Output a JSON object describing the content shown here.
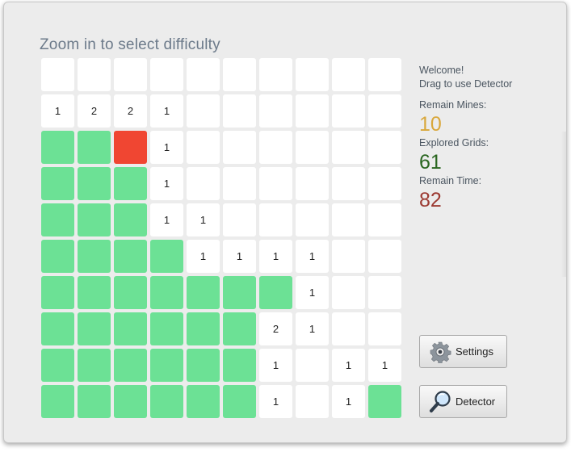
{
  "title": "Zoom in to select difficulty",
  "board": {
    "rows": [
      [
        "",
        "",
        "",
        "",
        "",
        "",
        "",
        "",
        "",
        ""
      ],
      [
        "1",
        "2",
        "2",
        "1",
        "",
        "",
        "",
        "",
        "",
        ""
      ],
      [
        "#",
        "#",
        "*",
        "1",
        "",
        "",
        "",
        "",
        "",
        ""
      ],
      [
        "#",
        "#",
        "#",
        "1",
        "",
        "",
        "",
        "",
        "",
        ""
      ],
      [
        "#",
        "#",
        "#",
        "1",
        "1",
        "",
        "",
        "",
        "",
        ""
      ],
      [
        "#",
        "#",
        "#",
        "#",
        "1",
        "1",
        "1",
        "1",
        "",
        ""
      ],
      [
        "#",
        "#",
        "#",
        "#",
        "#",
        "#",
        "#",
        "1",
        "",
        ""
      ],
      [
        "#",
        "#",
        "#",
        "#",
        "#",
        "#",
        "2",
        "1",
        "",
        ""
      ],
      [
        "#",
        "#",
        "#",
        "#",
        "#",
        "#",
        "1",
        "",
        "1",
        "1"
      ],
      [
        "#",
        "#",
        "#",
        "#",
        "#",
        "#",
        "1",
        "",
        "1",
        "#"
      ]
    ],
    "colors": {
      "open": "#ffffff",
      "covered": "#6ce195",
      "mine": "#f04632"
    }
  },
  "status": {
    "welcome": "Welcome!",
    "hint": "Drag to use Detector",
    "mines_label": "Remain Mines:",
    "mines_value": "10",
    "explored_label": "Explored Grids:",
    "explored_value": "61",
    "time_label": "Remain Time:",
    "time_value": "82"
  },
  "buttons": {
    "settings": {
      "label": "Settings",
      "icon": "gear-icon"
    },
    "detector": {
      "label": "Detector",
      "icon": "magnifier-icon"
    }
  }
}
